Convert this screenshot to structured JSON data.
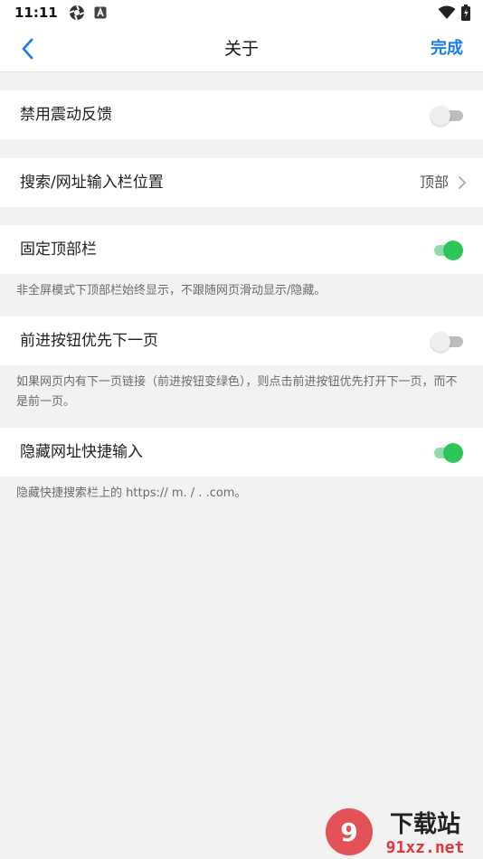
{
  "status_bar": {
    "time": "11:11"
  },
  "nav": {
    "title": "关于",
    "done_label": "完成"
  },
  "settings": {
    "disable_vibration": {
      "label": "禁用震动反馈",
      "enabled": false
    },
    "search_bar_position": {
      "label": "搜索/网址输入栏位置",
      "value": "顶部"
    },
    "fixed_top_bar": {
      "label": "固定顶部栏",
      "enabled": true,
      "description": "非全屏模式下顶部栏始终显示，不跟随网页滑动显示/隐藏。"
    },
    "forward_next_page": {
      "label": "前进按钮优先下一页",
      "enabled": false,
      "description": "如果网页内有下一页链接（前进按钮变绿色），则点击前进按钮优先打开下一页，而不是前一页。"
    },
    "hide_url_shortcuts": {
      "label": "隐藏网址快捷输入",
      "enabled": true,
      "description": "隐藏快捷搜索栏上的 https:// m. / . .com。"
    }
  },
  "watermark": {
    "brand": "下载站",
    "domain": "91xz.net"
  },
  "colors": {
    "accent": "#1a7ee8",
    "toggle_on": "#2ec65b",
    "toggle_off": "#bdbdbd",
    "background": "#f2f2f2"
  }
}
